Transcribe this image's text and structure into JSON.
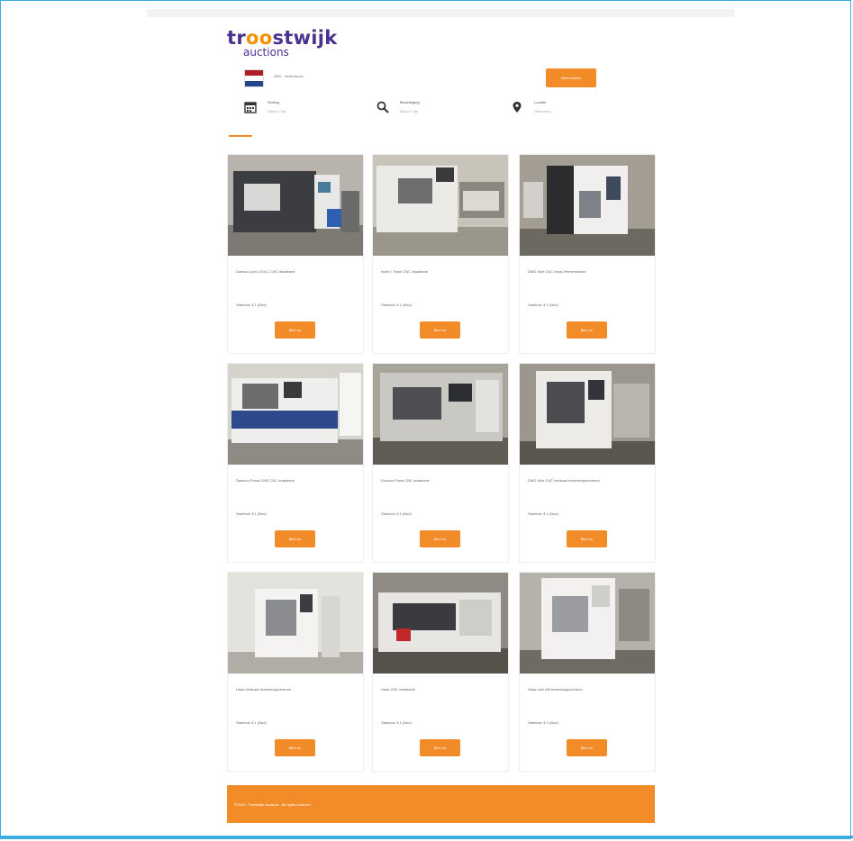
{
  "brand": {
    "logo_line1_a": "tr",
    "logo_line1_b": "oo",
    "logo_line1_c": "stwijk",
    "logo_line2": "auctions",
    "color_orange": "#f28c28",
    "color_purple": "#4a3190"
  },
  "header": {
    "language_label": "NED - Nederlands",
    "top_button_label": "Meer kavels"
  },
  "info_bar": [
    {
      "icon": "calendar-icon",
      "label": "Sluiting",
      "value": "Datum / tijd"
    },
    {
      "icon": "search-icon",
      "label": "Bezichtiging",
      "value": "Datum / tijd"
    },
    {
      "icon": "map-pin-icon",
      "label": "Locatie",
      "value": "Nederland"
    }
  ],
  "cards": [
    {
      "title": "Daewoo Lynx 220LC CNC draaibank",
      "price": "Startbod: € 1 (Bod)",
      "button": "Bied nu"
    },
    {
      "title": "Index / Traub CNC draaibank",
      "price": "Startbod: € 1 (Bod)",
      "button": "Bied nu"
    },
    {
      "title": "DMG Mori CNC draai-/freesmachine",
      "price": "Startbod: € 1 (Bod)",
      "button": "Bied nu"
    },
    {
      "title": "Daewoo Puma 2000 CNC draaibank",
      "price": "Startbod: € 1 (Bod)",
      "button": "Bied nu"
    },
    {
      "title": "Doosan Puma CNC draaibank",
      "price": "Startbod: € 1 (Bod)",
      "button": "Bied nu"
    },
    {
      "title": "DMG Mori CNC verticaal bewerkingscentrum",
      "price": "Startbod: € 1 (Bod)",
      "button": "Bied nu"
    },
    {
      "title": "Haas verticaal bewerkingscentrum",
      "price": "Startbod: € 1 (Bod)",
      "button": "Bied nu"
    },
    {
      "title": "Haas CNC draaibank",
      "price": "Startbod: € 1 (Bod)",
      "button": "Bied nu"
    },
    {
      "title": "Haas mini mill bewerkingscentrum",
      "price": "Startbod: € 1 (Bod)",
      "button": "Bied nu"
    }
  ],
  "footer": {
    "text": "©2024 - Troostwijk Auctions - All rights reserved"
  }
}
